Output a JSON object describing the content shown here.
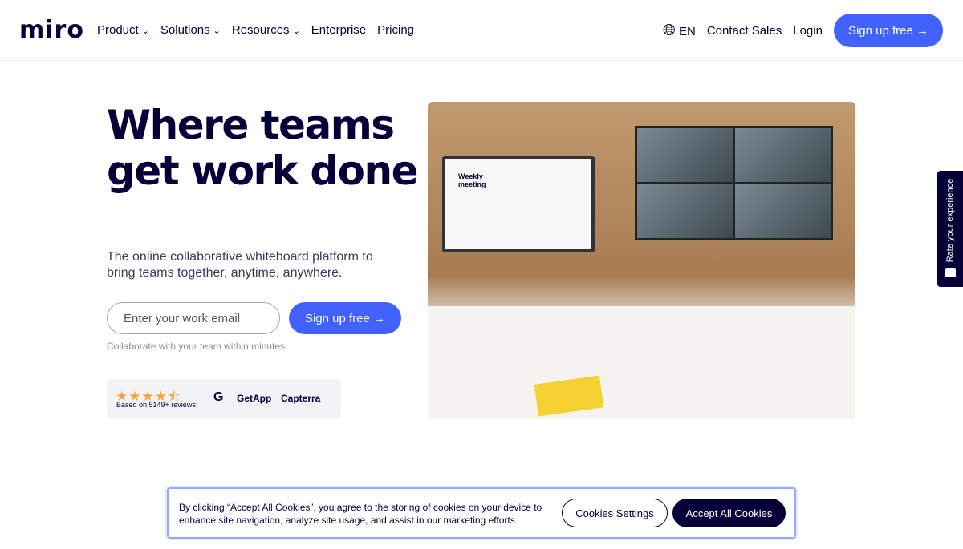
{
  "nav": {
    "logo": "miro",
    "items": [
      {
        "label": "Product",
        "dropdown": true
      },
      {
        "label": "Solutions",
        "dropdown": true
      },
      {
        "label": "Resources",
        "dropdown": true
      },
      {
        "label": "Enterprise"
      },
      {
        "label": "Pricing"
      }
    ],
    "language": "EN",
    "contact": "Contact Sales",
    "login": "Login",
    "signup": "Sign up free →"
  },
  "hero": {
    "title": "Where teams get work done",
    "subtitle": "The online collaborative whiteboard platform to bring teams together, anytime, anywhere.",
    "email_placeholder": "Enter your work email",
    "signup": "Sign up free →",
    "hint": "Collaborate with your team within minutes"
  },
  "reviews": {
    "rating": 4.5,
    "based": "Based on 5149+ reviews:",
    "g2": "G2",
    "getapp": "GetApp",
    "capterra": "Capterra"
  },
  "board": {
    "title": "Weekly meeting"
  },
  "cookie": {
    "text": "By clicking “Accept All Cookies”, you agree to the storing of cookies on your device to enhance site navigation, analyze site usage, and assist in our marketing efforts.",
    "settings": "Cookies Settings",
    "accept": "Accept All Cookies"
  },
  "feedback": {
    "label": "Rate your experience"
  },
  "colors": {
    "brand": "#4262ff",
    "dark": "#050038",
    "star": "#f5a43a"
  }
}
